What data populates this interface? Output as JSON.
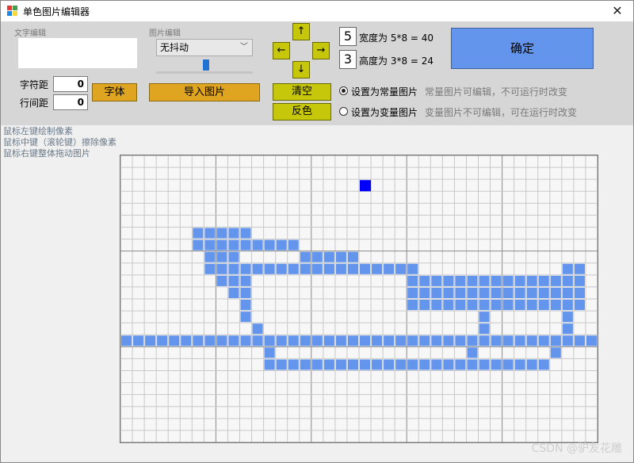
{
  "window": {
    "title": "单色图片编辑器"
  },
  "text_edit": {
    "label": "文字编辑",
    "value": ""
  },
  "char_spacing": {
    "label": "字符距",
    "value": "0"
  },
  "line_spacing": {
    "label": "行间距",
    "value": "0"
  },
  "buttons": {
    "font": "字体",
    "import": "导入图片",
    "clear": "清空",
    "invert": "反色",
    "confirm": "确定"
  },
  "image_edit": {
    "label": "图片编辑",
    "dither_selected": "无抖动",
    "slider_level": 0.52
  },
  "arrows": {
    "up": "↑",
    "down": "↓",
    "left": "←",
    "right": "→"
  },
  "size": {
    "width_count": "5",
    "width_text": "宽度为 5*8 = 40",
    "height_count": "3",
    "height_text": "高度为 3*8 = 24"
  },
  "mode": {
    "constant_label": "设置为常量图片",
    "constant_hint": "常量图片可编辑，不可运行时改变",
    "variable_label": "设置为变量图片",
    "variable_hint": "变量图片不可编辑，可在运行时改变",
    "selected": "constant"
  },
  "help": {
    "line1": "鼠标左键绘制像素",
    "line2": "鼠标中键（滚轮键）擦除像素",
    "line3": "鼠标右键整体拖动图片"
  },
  "watermark": "CSDN @驴友花雕",
  "colors": {
    "pixel_on": "#6495ed",
    "cursor": "#0000ff",
    "grid": "#c8c8c8",
    "grid_major": "#8a8a8a"
  },
  "pixel_grid": {
    "cols": 40,
    "rows": 24,
    "cursor": [
      20,
      2
    ],
    "on": [
      [
        6,
        6
      ],
      [
        7,
        6
      ],
      [
        8,
        6
      ],
      [
        9,
        6
      ],
      [
        10,
        6
      ],
      [
        6,
        7
      ],
      [
        7,
        7
      ],
      [
        8,
        7
      ],
      [
        9,
        7
      ],
      [
        10,
        7
      ],
      [
        11,
        7
      ],
      [
        12,
        7
      ],
      [
        13,
        7
      ],
      [
        14,
        7
      ],
      [
        7,
        8
      ],
      [
        8,
        8
      ],
      [
        9,
        8
      ],
      [
        15,
        8
      ],
      [
        16,
        8
      ],
      [
        17,
        8
      ],
      [
        18,
        8
      ],
      [
        19,
        8
      ],
      [
        7,
        9
      ],
      [
        8,
        9
      ],
      [
        9,
        9
      ],
      [
        10,
        9
      ],
      [
        11,
        9
      ],
      [
        12,
        9
      ],
      [
        13,
        9
      ],
      [
        14,
        9
      ],
      [
        15,
        9
      ],
      [
        16,
        9
      ],
      [
        17,
        9
      ],
      [
        18,
        9
      ],
      [
        19,
        9
      ],
      [
        20,
        9
      ],
      [
        21,
        9
      ],
      [
        22,
        9
      ],
      [
        23,
        9
      ],
      [
        24,
        9
      ],
      [
        37,
        9
      ],
      [
        38,
        9
      ],
      [
        8,
        10
      ],
      [
        9,
        10
      ],
      [
        10,
        10
      ],
      [
        24,
        10
      ],
      [
        25,
        10
      ],
      [
        26,
        10
      ],
      [
        27,
        10
      ],
      [
        28,
        10
      ],
      [
        29,
        10
      ],
      [
        30,
        10
      ],
      [
        31,
        10
      ],
      [
        32,
        10
      ],
      [
        33,
        10
      ],
      [
        34,
        10
      ],
      [
        35,
        10
      ],
      [
        36,
        10
      ],
      [
        37,
        10
      ],
      [
        38,
        10
      ],
      [
        9,
        11
      ],
      [
        10,
        11
      ],
      [
        24,
        11
      ],
      [
        25,
        11
      ],
      [
        26,
        11
      ],
      [
        27,
        11
      ],
      [
        28,
        11
      ],
      [
        29,
        11
      ],
      [
        30,
        11
      ],
      [
        31,
        11
      ],
      [
        32,
        11
      ],
      [
        33,
        11
      ],
      [
        34,
        11
      ],
      [
        35,
        11
      ],
      [
        36,
        11
      ],
      [
        37,
        11
      ],
      [
        38,
        11
      ],
      [
        10,
        12
      ],
      [
        24,
        12
      ],
      [
        25,
        12
      ],
      [
        26,
        12
      ],
      [
        27,
        12
      ],
      [
        28,
        12
      ],
      [
        29,
        12
      ],
      [
        30,
        12
      ],
      [
        31,
        12
      ],
      [
        32,
        12
      ],
      [
        33,
        12
      ],
      [
        34,
        12
      ],
      [
        35,
        12
      ],
      [
        36,
        12
      ],
      [
        37,
        12
      ],
      [
        38,
        12
      ],
      [
        10,
        13
      ],
      [
        30,
        13
      ],
      [
        37,
        13
      ],
      [
        11,
        14
      ],
      [
        30,
        14
      ],
      [
        37,
        14
      ],
      [
        0,
        15
      ],
      [
        1,
        15
      ],
      [
        2,
        15
      ],
      [
        3,
        15
      ],
      [
        4,
        15
      ],
      [
        5,
        15
      ],
      [
        6,
        15
      ],
      [
        7,
        15
      ],
      [
        8,
        15
      ],
      [
        9,
        15
      ],
      [
        10,
        15
      ],
      [
        11,
        15
      ],
      [
        12,
        15
      ],
      [
        13,
        15
      ],
      [
        14,
        15
      ],
      [
        15,
        15
      ],
      [
        16,
        15
      ],
      [
        17,
        15
      ],
      [
        18,
        15
      ],
      [
        19,
        15
      ],
      [
        20,
        15
      ],
      [
        21,
        15
      ],
      [
        22,
        15
      ],
      [
        23,
        15
      ],
      [
        24,
        15
      ],
      [
        25,
        15
      ],
      [
        26,
        15
      ],
      [
        27,
        15
      ],
      [
        28,
        15
      ],
      [
        29,
        15
      ],
      [
        30,
        15
      ],
      [
        31,
        15
      ],
      [
        32,
        15
      ],
      [
        33,
        15
      ],
      [
        34,
        15
      ],
      [
        35,
        15
      ],
      [
        36,
        15
      ],
      [
        37,
        15
      ],
      [
        38,
        15
      ],
      [
        39,
        15
      ],
      [
        12,
        16
      ],
      [
        29,
        16
      ],
      [
        36,
        16
      ],
      [
        12,
        17
      ],
      [
        13,
        17
      ],
      [
        14,
        17
      ],
      [
        15,
        17
      ],
      [
        16,
        17
      ],
      [
        17,
        17
      ],
      [
        18,
        17
      ],
      [
        19,
        17
      ],
      [
        20,
        17
      ],
      [
        21,
        17
      ],
      [
        22,
        17
      ],
      [
        23,
        17
      ],
      [
        24,
        17
      ],
      [
        25,
        17
      ],
      [
        26,
        17
      ],
      [
        27,
        17
      ],
      [
        28,
        17
      ],
      [
        29,
        17
      ],
      [
        30,
        17
      ],
      [
        31,
        17
      ],
      [
        32,
        17
      ],
      [
        33,
        17
      ],
      [
        34,
        17
      ],
      [
        35,
        17
      ]
    ]
  }
}
